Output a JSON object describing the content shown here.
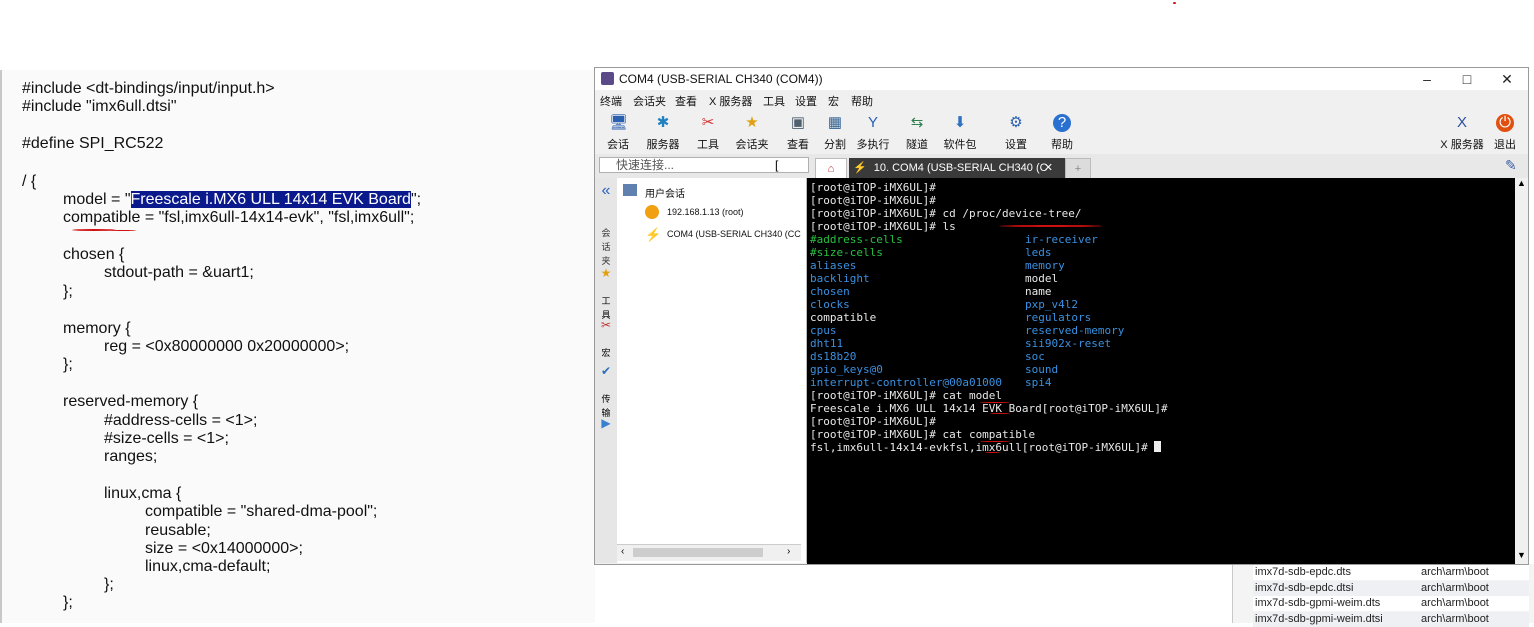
{
  "code": {
    "lines": [
      "#include <dt-bindings/input/input.h>",
      "#include \"imx6ull.dtsi\"",
      "",
      "#define SPI_RC522",
      "",
      "/ {",
      "model_line",
      "compatible = \"fsl,imx6ull-14x14-evk\", \"fsl,imx6ull\";",
      "",
      "chosen {",
      "stdout-path = &uart1;",
      "};",
      "",
      "memory {",
      "reg = <0x80000000 0x20000000>;",
      "};",
      "",
      "reserved-memory {",
      "#address-cells = <1>;",
      "#size-cells = <1>;",
      "ranges;",
      "",
      "linux,cma {",
      "compatible = \"shared-dma-pool\";",
      "reusable;",
      "size = <0x14000000>;",
      "linux,cma-default;",
      "};",
      "};"
    ],
    "model_prefix": "model = \"",
    "model_selected": "Freescale i.MX6 ULL 14x14 EVK Board",
    "model_suffix": "\";"
  },
  "file_list": [
    {
      "name": "imx7d-sdb-epdc.dts",
      "path": "arch\\arm\\boot"
    },
    {
      "name": "imx7d-sdb-epdc.dtsi",
      "path": "arch\\arm\\boot"
    },
    {
      "name": "imx7d-sdb-gpmi-weim.dts",
      "path": "arch\\arm\\boot"
    },
    {
      "name": "imx7d-sdb-gpmi-weim.dtsi",
      "path": "arch\\arm\\boot"
    }
  ],
  "window": {
    "title": "COM4  (USB-SERIAL CH340 (COM4))",
    "controls": {
      "minimize": "–",
      "maximize": "□",
      "close": "✕"
    },
    "menu": [
      "终端",
      "会话夹",
      "查看",
      "X 服务器",
      "工具",
      "设置",
      "宏",
      "帮助"
    ],
    "toolbar": [
      {
        "label": "会话",
        "icon": "session-icon"
      },
      {
        "label": "服务器",
        "icon": "servers-icon"
      },
      {
        "label": "工具",
        "icon": "tools-icon"
      },
      {
        "label": "会话夹",
        "icon": "star-icon"
      },
      {
        "label": "查看",
        "icon": "view-icon"
      },
      {
        "label": "分割",
        "icon": "split-icon"
      },
      {
        "label": "多执行",
        "icon": "multiexec-icon"
      },
      {
        "label": "隧道",
        "icon": "tunnel-icon"
      },
      {
        "label": "软件包",
        "icon": "packages-icon"
      },
      {
        "label": "设置",
        "icon": "settings-icon"
      },
      {
        "label": "帮助",
        "icon": "help-icon"
      }
    ],
    "toolbar_right": [
      {
        "label": "X 服务器",
        "icon": "x-server-icon"
      },
      {
        "label": "退出",
        "icon": "exit-icon"
      }
    ],
    "quick_connect_placeholder": "快速连接...",
    "active_tab": "10. COM4  (USB-SERIAL CH340 (C",
    "sessions": {
      "root": "用户会话",
      "items": [
        "192.168.1.13 (root)",
        "COM4  (USB-SERIAL CH340 (CC"
      ]
    },
    "colors": {
      "terminal_bg": "#000000",
      "dir_color": "#3a90e0",
      "selection": "#0a1a8c",
      "annotation": "#d01010"
    }
  },
  "terminal": {
    "prompt": "[root@iTOP-iMX6UL]#",
    "pre_lines": [
      "[root@iTOP-iMX6UL]#",
      "[root@iTOP-iMX6UL]#",
      "[root@iTOP-iMX6UL]# cd /proc/device-tree/",
      "[root@iTOP-iMX6UL]# ls"
    ],
    "ls_left": [
      {
        "name": "#address-cells",
        "kind": "file",
        "color": "green"
      },
      {
        "name": "#size-cells",
        "kind": "file",
        "color": "green"
      },
      {
        "name": "aliases",
        "kind": "dir"
      },
      {
        "name": "backlight",
        "kind": "dir"
      },
      {
        "name": "chosen",
        "kind": "dir"
      },
      {
        "name": "clocks",
        "kind": "dir"
      },
      {
        "name": "compatible",
        "kind": "file"
      },
      {
        "name": "cpus",
        "kind": "dir"
      },
      {
        "name": "dht11",
        "kind": "dir"
      },
      {
        "name": "ds18b20",
        "kind": "dir"
      },
      {
        "name": "gpio_keys@0",
        "kind": "dir"
      },
      {
        "name": "interrupt-controller@00a01000",
        "kind": "dir"
      }
    ],
    "ls_right": [
      {
        "name": "ir-receiver",
        "kind": "dir"
      },
      {
        "name": "leds",
        "kind": "dir"
      },
      {
        "name": "memory",
        "kind": "dir"
      },
      {
        "name": "model",
        "kind": "file"
      },
      {
        "name": "name",
        "kind": "file"
      },
      {
        "name": "pxp_v4l2",
        "kind": "dir"
      },
      {
        "name": "regulators",
        "kind": "dir"
      },
      {
        "name": "reserved-memory",
        "kind": "dir"
      },
      {
        "name": "sii902x-reset",
        "kind": "dir"
      },
      {
        "name": "soc",
        "kind": "dir"
      },
      {
        "name": "sound",
        "kind": "dir"
      },
      {
        "name": "spi4",
        "kind": "dir"
      }
    ],
    "post_lines": [
      "[root@iTOP-iMX6UL]# cat model",
      "Freescale i.MX6 ULL 14x14 EVK Board[root@iTOP-iMX6UL]#",
      "[root@iTOP-iMX6UL]#",
      "[root@iTOP-iMX6UL]# cat compatible",
      "fsl,imx6ull-14x14-evkfsl,imx6ull[root@iTOP-iMX6UL]# "
    ]
  }
}
